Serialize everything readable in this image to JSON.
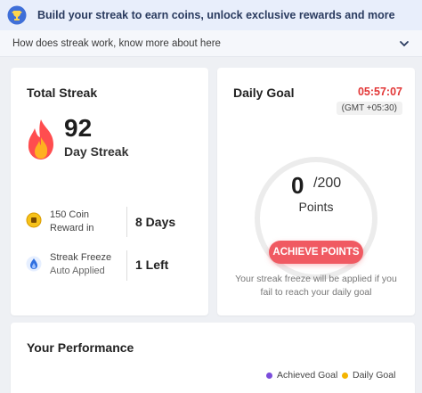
{
  "banner": {
    "text": "Build your streak to earn coins, unlock exclusive rewards and more",
    "icon": "trophy-icon"
  },
  "how_bar": {
    "text": "How does streak work, know more about here",
    "icon": "chevron-down-icon"
  },
  "total_streak": {
    "title": "Total Streak",
    "count": "92",
    "label": "Day Streak",
    "rows": [
      {
        "icon": "coin-icon",
        "line1": "150 Coin",
        "line2": "Reward in",
        "value": "8 Days"
      },
      {
        "icon": "freeze-shield-icon",
        "line1": "Streak Freeze",
        "line2": "Auto Applied",
        "value": "1 Left"
      }
    ]
  },
  "daily_goal": {
    "title": "Daily Goal",
    "timer": "05:57:07",
    "timezone": "(GMT +05:30)",
    "points": "0",
    "points_total": "/200",
    "points_label": "Points",
    "button": "ACHIEVE POINTS",
    "note": "Your streak freeze will be applied if you fail to reach your daily goal"
  },
  "performance": {
    "title": "Your Performance",
    "legend": [
      {
        "label": "Achieved Goal",
        "color": "#7b4ddb"
      },
      {
        "label": "Daily Goal",
        "color": "#f4b400"
      }
    ]
  },
  "colors": {
    "accent_red": "#f05a62",
    "timer_red": "#e23636",
    "flame_orange": "#ff6a2b"
  }
}
